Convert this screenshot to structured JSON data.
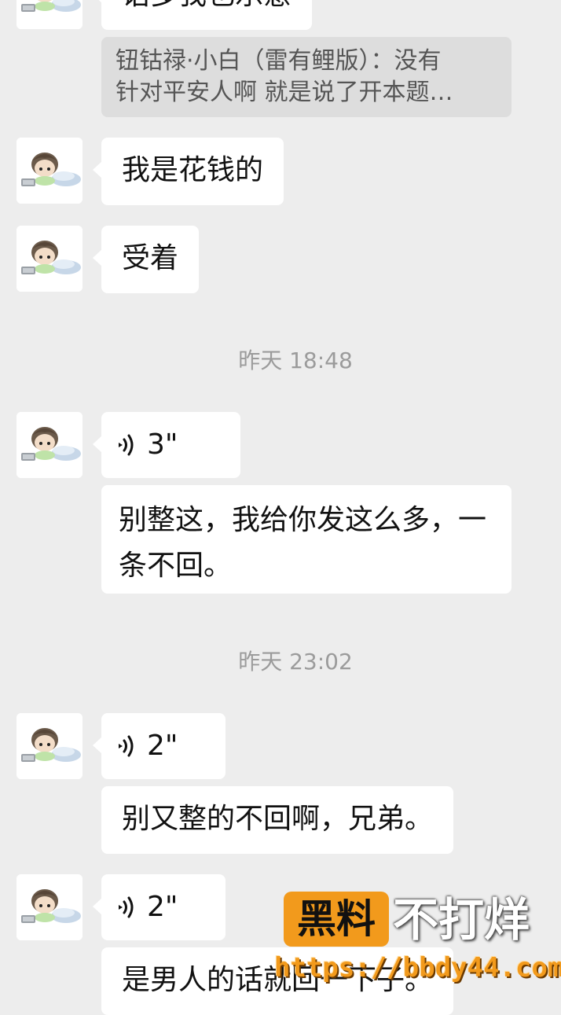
{
  "messages": [
    {
      "type": "text",
      "text": "话多我也乐意"
    },
    {
      "type": "quote",
      "line1": "钮钴禄·小白（雷有鲤版）：没有",
      "line2": "针对平安人啊 就是说了开本题…"
    },
    {
      "type": "text",
      "text": "我是花钱的"
    },
    {
      "type": "text",
      "text": "受着"
    },
    {
      "type": "time",
      "text": "昨天 18:48"
    },
    {
      "type": "voice",
      "duration": "3\""
    },
    {
      "type": "text",
      "text": "别整这，我给你发这么多，一条不回。"
    },
    {
      "type": "time",
      "text": "昨天 23:02"
    },
    {
      "type": "voice",
      "duration": "2\""
    },
    {
      "type": "text",
      "text": "别又整的不回啊，兄弟。"
    },
    {
      "type": "voice",
      "duration": "2\""
    },
    {
      "type": "text",
      "text": "是男人的话就回一下子。"
    }
  ],
  "watermark": {
    "brand_box": "黑料",
    "brand_text": "不打烊",
    "url": "https://bbdy44.com",
    "accent": "#f29a1c"
  },
  "colors": {
    "background": "#ededed",
    "bubble": "#ffffff",
    "quote_bg": "#dddddd",
    "timestamp": "#9b9b9b"
  }
}
